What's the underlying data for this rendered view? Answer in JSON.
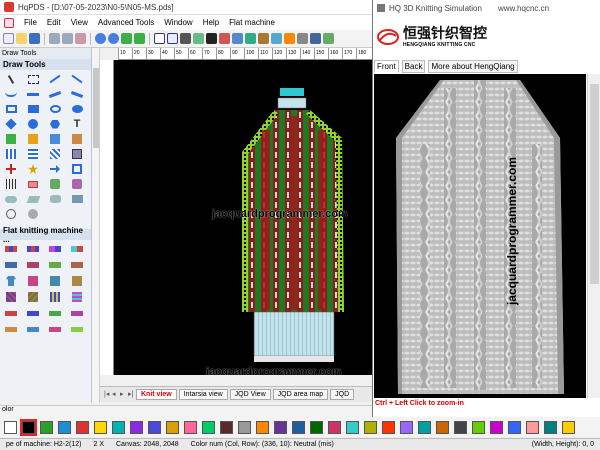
{
  "window": {
    "title": "HqPDS - [D:\\07-05-2023\\N0-5\\N05-MS.pds]"
  },
  "menu": {
    "items": [
      "File",
      "Edit",
      "View",
      "Advanced Tools",
      "Window",
      "Help",
      "Flat machine"
    ]
  },
  "panel": {
    "header": "Draw Tools",
    "section_draw": "Draw Tools",
    "section_flat": "Flat knitting machine ..."
  },
  "ruler": {
    "ticks": [
      "10",
      "20",
      "30",
      "40",
      "50",
      "60",
      "70",
      "80",
      "90",
      "100",
      "110",
      "120",
      "130",
      "140",
      "150",
      "160",
      "170",
      "180"
    ]
  },
  "canvas": {
    "watermark_1": "jacquardprogrammer.com",
    "watermark_2": "jacquardprogrammer.com"
  },
  "tabs": {
    "items": [
      "Knit view",
      "Intarsia view",
      "JQD View",
      "JQD area map",
      "JQD"
    ],
    "active": "Knit view"
  },
  "colors": {
    "label": "olor",
    "swatches": [
      "#ffffff",
      "#000000",
      "#2aa02a",
      "#1a8fd8",
      "#e03030",
      "#ffd800",
      "#00b2b2",
      "#8a2be2",
      "#4a4ad8",
      "#d8a000",
      "#ff6699",
      "#00cc66",
      "#5a2a2a",
      "#999999",
      "#ff8800",
      "#663399",
      "#1f5f9f",
      "#006600",
      "#cc3366",
      "#33cccc",
      "#b0b000",
      "#ff3300",
      "#9966ff",
      "#00a0a0",
      "#cc6600",
      "#444444",
      "#66cc00",
      "#cc00cc",
      "#3366ff",
      "#ff9999",
      "#008080",
      "#ffcc00"
    ]
  },
  "status": {
    "machine": "pe of machine: H2-2(12)",
    "x": "2 X",
    "canvas": "Canvas: 2048, 2048",
    "color": "Color num (Col, Row): (336, 10): Neutral (mis)",
    "size": "(Width, Height): 0, 0"
  },
  "sim": {
    "title": "HQ 3D Knitting Simulation",
    "url": "www.hqcnc.cn",
    "logo_cn": "恒强针织智控",
    "logo_en": "HENGQIANG KNITTING CNC",
    "nav": [
      "Front",
      "Back",
      "More about HengQiang"
    ],
    "active_nav": "Front",
    "watermark": "jacquardprogrammer.com",
    "hint": "Ctrl + Left Click to zoom-in"
  }
}
